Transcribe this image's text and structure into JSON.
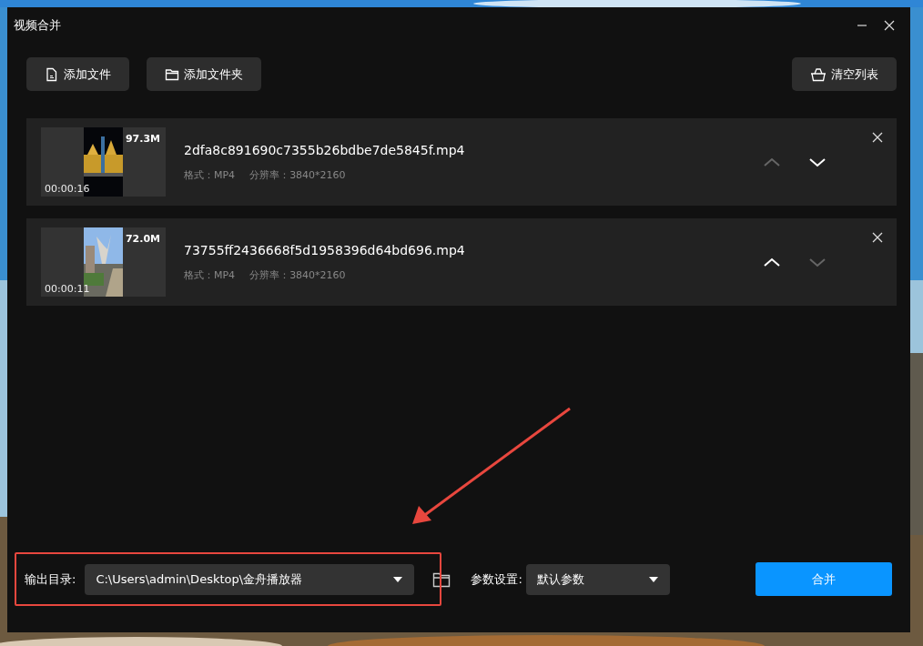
{
  "window": {
    "title": "视频合并"
  },
  "toolbar": {
    "buttons": [
      {
        "label": "添加文件",
        "kind": "file"
      },
      {
        "label": "添加文件夹",
        "kind": "folder"
      }
    ],
    "clear_button": {
      "label": "清空列表"
    }
  },
  "files": [
    {
      "name": "2dfa8c891690c7355b26bdbe7de5845f.mp4",
      "size": "97.3M",
      "duration": "00:00:16",
      "format": "格式：MP4",
      "resolution": "分辨率：3840*2160",
      "can_move_up": false,
      "can_move_down": true
    },
    {
      "name": "73755ff2436668f5d1958396d64bd696.mp4",
      "size": "72.0M",
      "duration": "00:00:11",
      "format": "格式：MP4",
      "resolution": "分辨率：3840*2160",
      "can_move_up": true,
      "can_move_down": false
    }
  ],
  "output": {
    "label": "输出目录:",
    "path": "C:\\Users\\admin\\Desktop\\金舟播放器"
  },
  "params": {
    "label": "参数设置:",
    "value": "默认参数"
  },
  "merge_button": {
    "label": "合并"
  }
}
